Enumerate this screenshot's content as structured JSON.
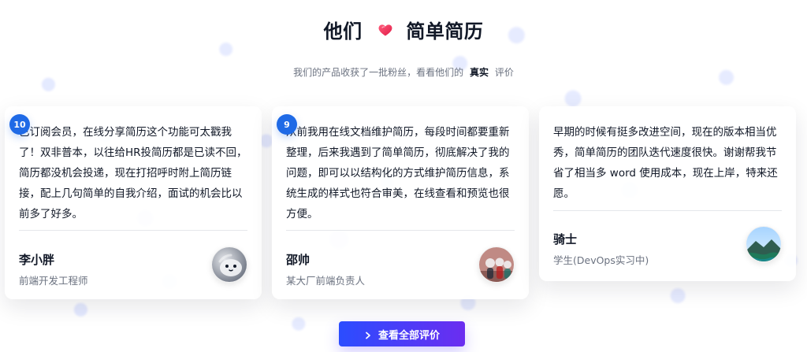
{
  "header": {
    "title_left": "他们",
    "title_right": "简单简历",
    "heart_icon": "heart-icon",
    "subtitle_prefix": "我们的产品收获了一批粉丝，看看他们的",
    "subtitle_highlight": "真实",
    "subtitle_suffix": "评价"
  },
  "testimonials": [
    {
      "badge": "10",
      "text": "已订阅会员，在线分享简历这个功能可太戳我了！双非普本，以往给HR投简历都是已读不回，简历都没机会投递，现在打招呼时附上简历链接，配上几句简单的自我介绍，面试的机会比以前多了好多。",
      "name": "李小胖",
      "role": "前端开发工程师",
      "avatar_icon": "avatar-icon"
    },
    {
      "badge": "9",
      "text": "从前我用在线文档维护简历，每段时间都要重新整理，后来我遇到了简单简历，彻底解决了我的问题，即可以以结构化的方式维护简历信息，系统生成的样式也符合审美，在线查看和预览也很方便。",
      "name": "邵帅",
      "role": "某大厂前端负责人",
      "avatar_icon": "avatar-icon"
    },
    {
      "text": "早期的时候有挺多改进空间，现在的版本相当优秀，简单简历的团队迭代速度很快。谢谢帮我节省了相当多 word 使用成本，现在上岸，特来还愿。",
      "name": "骑士",
      "role": "学生(DevOps实习中)",
      "avatar_icon": "avatar-icon"
    }
  ],
  "cta": {
    "label": "查看全部评价",
    "chevron_icon": "chevron-right-icon"
  },
  "colors": {
    "accent_blue": "#1f6ae6",
    "cta_start": "#2b4dff",
    "cta_end": "#6b2df0",
    "heart_red": "#e11d48"
  }
}
